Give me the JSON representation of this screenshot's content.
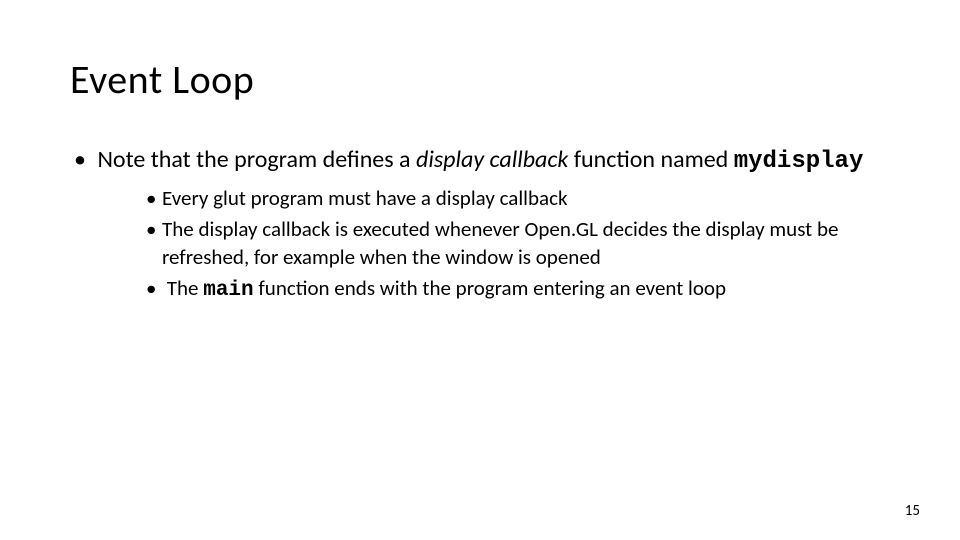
{
  "slide": {
    "title": "Event Loop",
    "bullet1": {
      "pre": "Note that the program defines a ",
      "em": "display callback",
      "mid": " function named ",
      "code": "mydisplay"
    },
    "sub1": "Every glut program must have a display callback",
    "sub2": "The display callback is executed whenever Open.GL decides the display must be refreshed, for example when the window is opened",
    "sub3_pre": "The ",
    "sub3_code": "main",
    "sub3_post": " function ends with the program entering an event loop",
    "page": "15"
  }
}
